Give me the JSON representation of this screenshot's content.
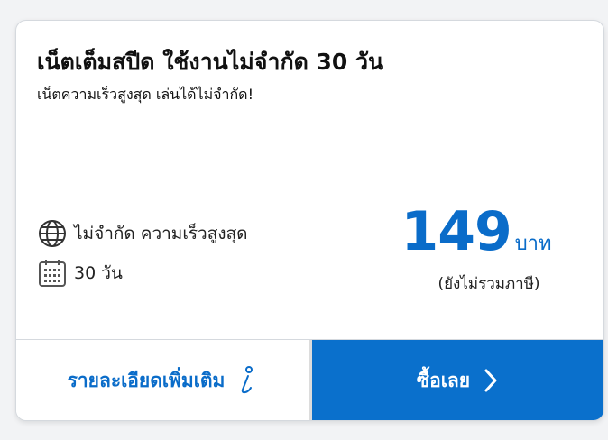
{
  "package": {
    "title": "เน็ตเต็มสปีด ใช้งานไม่จำกัด 30 วัน",
    "subtitle": "เน็ตความเร็วสูงสุด เล่นได้ไม่จำกัด!"
  },
  "features": [
    {
      "icon": "globe-icon",
      "text": "ไม่จำกัด ความเร็วสูงสุด"
    },
    {
      "icon": "calendar-icon",
      "text": "30 วัน"
    }
  ],
  "price": {
    "amount": "149",
    "unit": "บาท",
    "note": "(ยังไม่รวมภาษี)"
  },
  "actions": {
    "more_details_label": "รายละเอียดเพิ่มเติม",
    "more_details_icon": "info-icon",
    "buy_label": "ซื้อเลย",
    "buy_icon": "chevron-right-icon"
  },
  "colors": {
    "accent": "#0a6cc9",
    "buy_button_bg": "#0a70cc",
    "text": "#111111"
  }
}
